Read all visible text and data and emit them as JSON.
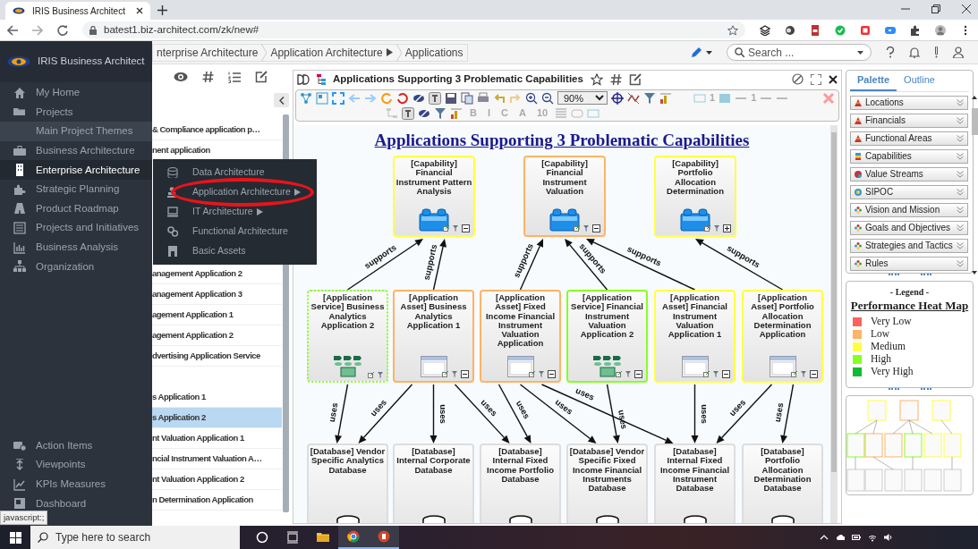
{
  "browser": {
    "tab_title": "IRIS Business Architect",
    "url": "batest1.biz-architect.com/zk/new#"
  },
  "app": {
    "logo_text": "IRIS Business Architect"
  },
  "sidebar": {
    "items": [
      {
        "label": "My Home",
        "kind": "item",
        "selected": false
      },
      {
        "label": "Projects",
        "kind": "item",
        "selected": false
      },
      {
        "label": "Main Project Themes",
        "kind": "sub",
        "selected": false
      },
      {
        "label": "Business Architecture",
        "kind": "item",
        "selected": false
      },
      {
        "label": "Enterprise Architecture",
        "kind": "item",
        "selected": true
      },
      {
        "label": "Strategic Planning",
        "kind": "item",
        "selected": false
      },
      {
        "label": "Product Roadmap",
        "kind": "item",
        "selected": false
      },
      {
        "label": "Projects and Initiatives",
        "kind": "item",
        "selected": false
      },
      {
        "label": "Business Analysis",
        "kind": "item",
        "selected": false
      },
      {
        "label": "Organization",
        "kind": "item",
        "selected": false
      }
    ],
    "bottom_items": [
      {
        "label": "Action Items"
      },
      {
        "label": "Viewpoints"
      },
      {
        "label": "KPIs Measures"
      },
      {
        "label": "Dashboard"
      }
    ]
  },
  "flyout": {
    "items": [
      {
        "label": "Data Architecture",
        "has_submenu": false,
        "circled": false
      },
      {
        "label": "Application Architecture",
        "has_submenu": true,
        "circled": true
      },
      {
        "label": "IT Architecture",
        "has_submenu": true,
        "circled": false
      },
      {
        "label": "Functional Architecture",
        "has_submenu": false,
        "circled": false
      },
      {
        "label": "Basic Assets",
        "has_submenu": false,
        "circled": false
      }
    ]
  },
  "breadcrumbs": [
    {
      "label": "nterprise Architecture",
      "has_menu": false
    },
    {
      "label": "Application Architecture",
      "has_menu": true
    },
    {
      "label": "Applications",
      "has_menu": false
    }
  ],
  "header_search": {
    "placeholder": "Search ..."
  },
  "list_panel": {
    "items": [
      {
        "label": "& Compliance application p…",
        "selected": false
      },
      {
        "label": "nent application",
        "selected": false
      },
      {
        "label": "anagement Application 2",
        "selected": false
      },
      {
        "label": "anagement Application 3",
        "selected": false
      },
      {
        "label": "agement Application 1",
        "selected": false
      },
      {
        "label": "agement Application 2",
        "selected": false
      },
      {
        "label": "dvertising Application Service",
        "selected": false
      },
      {
        "label": "s Application 1",
        "selected": false
      },
      {
        "label": "s Application 2",
        "selected": true
      },
      {
        "label": "nt Valuation Application 1",
        "selected": false
      },
      {
        "label": "ncial Instrument Valuation A…",
        "selected": false
      },
      {
        "label": "nt Valuation Application 2",
        "selected": false
      },
      {
        "label": "n Determination Application",
        "selected": false
      }
    ]
  },
  "diagram": {
    "title": "Applications Supporting 3 Problematic Capabilities",
    "toolbar": {
      "zoom": "90%",
      "labels": [
        "1",
        "1",
        "B",
        "I",
        "C",
        "A",
        "10"
      ]
    },
    "heading": "Applications Supporting 3 Problematic Capabilities",
    "capabilities": [
      {
        "kind": "capability",
        "label": "[Capability] Financial Instrument Pattern Analysis",
        "color": "#ffff44",
        "dashed": false,
        "expanded": true
      },
      {
        "kind": "capability",
        "label": "[Capability] Financial Instrument Valuation",
        "color": "#ffb366",
        "dashed": false,
        "expanded": true
      },
      {
        "kind": "capability",
        "label": "[Capability] Portfolio Allocation Determination",
        "color": "#ffff44",
        "dashed": false,
        "expanded": false
      }
    ],
    "applications": [
      {
        "kind": "service",
        "label": "[Application Service] Business Analytics Application 2",
        "color": "#88ff22",
        "dashed": true,
        "links": [
          {
            "label": "supports"
          },
          {
            "label": "uses"
          }
        ]
      },
      {
        "kind": "asset",
        "label": "[Application Asset] Business Analytics Application 1",
        "color": "#ffb366",
        "dashed": false,
        "expanded": true,
        "links": [
          {
            "label": "supports"
          },
          {
            "label": "uses"
          },
          {
            "label": "uses"
          },
          {
            "label": "uses"
          }
        ]
      },
      {
        "kind": "asset",
        "label": "[Application Asset] Fixed Income Financial Instrument Valuation Application",
        "color": "#ffb366",
        "dashed": false,
        "expanded": true,
        "links": [
          {
            "label": "supports"
          },
          {
            "label": "uses"
          },
          {
            "label": "uses"
          },
          {
            "label": "uses"
          }
        ]
      },
      {
        "kind": "service",
        "label": "[Application Service] Financial Instrument Valuation Application 2",
        "color": "#88ff22",
        "dashed": false,
        "expanded": true,
        "links": [
          {
            "label": "supports"
          },
          {
            "label": "uses"
          }
        ]
      },
      {
        "kind": "asset",
        "label": "[Application Asset] Financial Instrument Valuation Application 1",
        "color": "#ffff44",
        "dashed": false,
        "expanded": true,
        "links": [
          {
            "label": "supports"
          },
          {
            "label": "uses"
          }
        ]
      },
      {
        "kind": "asset",
        "label": "[Application Asset] Portfolio Allocation Determination Application",
        "color": "#ffff44",
        "dashed": false,
        "expanded": true,
        "links": [
          {
            "label": "supports"
          },
          {
            "label": "uses"
          },
          {
            "label": "uses"
          }
        ]
      }
    ],
    "databases": [
      {
        "kind": "database",
        "label": "[Database] Vendor Specific Analytics Database"
      },
      {
        "kind": "database",
        "label": "[Database] Internal Corporate Database"
      },
      {
        "kind": "database",
        "label": "[Database] Internal Fixed Income Portfolio Database"
      },
      {
        "kind": "database",
        "label": "[Database] Vendor Specific Fixed Income Financial Instruments Database"
      },
      {
        "kind": "database",
        "label": "[Database] Internal Fixed Income Financial Instrument Database"
      },
      {
        "kind": "database",
        "label": "[Database] Portfolio Allocation Determination Database"
      }
    ]
  },
  "palette": {
    "tabs": [
      {
        "label": "Palette",
        "selected": true
      },
      {
        "label": "Outline",
        "selected": false
      }
    ],
    "items": [
      {
        "label": "Locations"
      },
      {
        "label": "Financials"
      },
      {
        "label": "Functional Areas"
      },
      {
        "label": "Capabilities"
      },
      {
        "label": "Value Streams"
      },
      {
        "label": "SIPOC"
      },
      {
        "label": "Vision and Mission"
      },
      {
        "label": "Goals and Objectives"
      },
      {
        "label": "Strategies and Tactics"
      },
      {
        "label": "Rules"
      }
    ]
  },
  "legend": {
    "caption": "- Legend -",
    "title": "Performance Heat Map",
    "items": [
      {
        "label": "Very Low",
        "color": "#ff6060"
      },
      {
        "label": "Low",
        "color": "#ffb366"
      },
      {
        "label": "Medium",
        "color": "#ffff44"
      },
      {
        "label": "High",
        "color": "#88ff22"
      },
      {
        "label": "Very High",
        "color": "#11bb33"
      }
    ]
  },
  "status_url": "javascript:;",
  "taskbar": {
    "search_placeholder": "Type here to search"
  }
}
